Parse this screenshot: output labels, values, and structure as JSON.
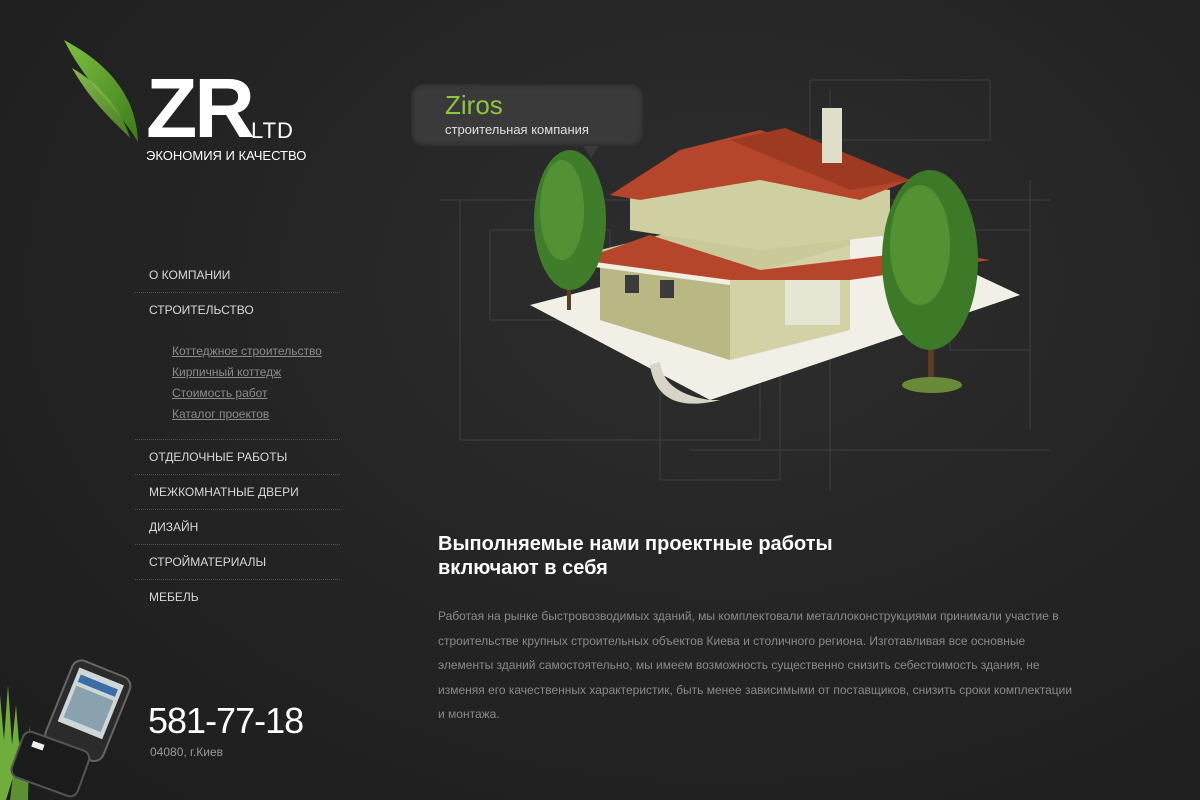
{
  "logo": {
    "mark": "ZR",
    "suffix": "LTD",
    "tagline": "ЭКОНОМИЯ И КАЧЕСТВО"
  },
  "nav": {
    "items": [
      {
        "label": "О КОМПАНИИ"
      },
      {
        "label": "СТРОИТЕЛЬСТВО"
      },
      {
        "label": "ОТДЕЛОЧНЫЕ РАБОТЫ"
      },
      {
        "label": "МЕЖКОМНАТНЫЕ ДВЕРИ"
      },
      {
        "label": "ДИЗАЙН"
      },
      {
        "label": "СТРОЙМАТЕРИАЛЫ"
      },
      {
        "label": "МЕБЕЛЬ"
      }
    ],
    "subitems": [
      {
        "label": "Коттеджное строительство"
      },
      {
        "label": "Кирпичный коттедж"
      },
      {
        "label": "Стоимость работ"
      },
      {
        "label": "Каталог проектов"
      }
    ]
  },
  "bubble": {
    "title": "Ziros",
    "subtitle": "строительная компания"
  },
  "content": {
    "heading_line1": "Выполняемые нами проектные работы",
    "heading_line2": "включают в себя",
    "body": "Работая на рынке быстровозводимых зданий, мы комплектовали металлоконструкциями принимали участие в строительстве крупных строительных объектов Киева и столичного региона. Изготавливая все основные элементы зданий самостоятельно, мы имеем возможность существенно снизить себестоимость здания, не изменяя его качественных характеристик, быть менее зависимыми от поставщиков, снизить сроки комплектации и монтажа."
  },
  "contact": {
    "phone": "581-77-18",
    "address": "04080, г.Киев"
  },
  "colors": {
    "background": "#232323",
    "accent_green": "#8dc63f",
    "roof": "#b5462c",
    "wall": "#c9c99a"
  },
  "icons": {
    "leaf": "leaf-icon",
    "house": "house-illustration",
    "phone": "mobile-phone-illustration"
  }
}
